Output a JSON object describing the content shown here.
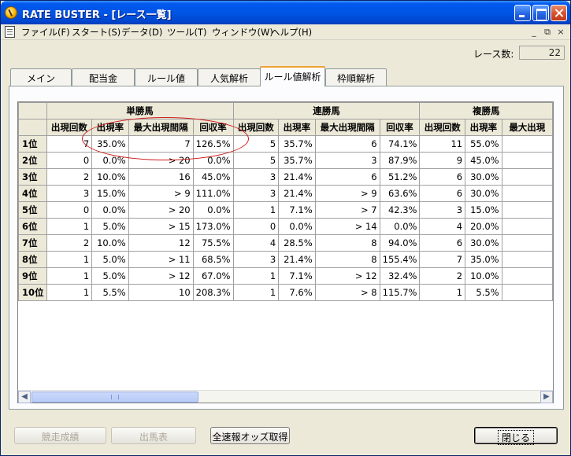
{
  "window": {
    "title": "RATE BUSTER - [レース一覧]"
  },
  "menu": {
    "items": [
      "ファイル(F)",
      "スタート(S)",
      "データ(D)",
      "ツール(T)",
      "ウィンドウ(W)",
      "ヘルプ(H)"
    ],
    "mdi_min": "_",
    "mdi_restore": "⧉",
    "mdi_close": "×"
  },
  "race_count": {
    "label": "レース数:",
    "value": "22"
  },
  "tabs": [
    "メイン",
    "配当金",
    "ルール値",
    "人気解析",
    "ルール値解析",
    "枠順解析"
  ],
  "active_tab": 4,
  "grid": {
    "groups": [
      "単勝馬",
      "連勝馬",
      "複勝馬"
    ],
    "columns": [
      "出現回数",
      "出現率",
      "最大出現間隔",
      "回収率",
      "出現回数",
      "出現率",
      "最大出現間隔",
      "回収率",
      "出現回数",
      "出現率",
      "最大出現"
    ],
    "rows": [
      {
        "label": "1位",
        "cells": [
          "7",
          "35.0%",
          "7",
          "126.5%",
          "5",
          "35.7%",
          "6",
          "74.1%",
          "11",
          "55.0%",
          ""
        ]
      },
      {
        "label": "2位",
        "cells": [
          "0",
          "0.0%",
          "> 20",
          "0.0%",
          "5",
          "35.7%",
          "3",
          "87.9%",
          "9",
          "45.0%",
          ""
        ]
      },
      {
        "label": "3位",
        "cells": [
          "2",
          "10.0%",
          "16",
          "45.0%",
          "3",
          "21.4%",
          "6",
          "51.2%",
          "6",
          "30.0%",
          ""
        ]
      },
      {
        "label": "4位",
        "cells": [
          "3",
          "15.0%",
          "> 9",
          "111.0%",
          "3",
          "21.4%",
          "> 9",
          "63.6%",
          "6",
          "30.0%",
          ""
        ]
      },
      {
        "label": "5位",
        "cells": [
          "0",
          "0.0%",
          "> 20",
          "0.0%",
          "1",
          "7.1%",
          "> 7",
          "42.3%",
          "3",
          "15.0%",
          ""
        ]
      },
      {
        "label": "6位",
        "cells": [
          "1",
          "5.0%",
          "> 15",
          "173.0%",
          "0",
          "0.0%",
          "> 14",
          "0.0%",
          "4",
          "20.0%",
          ""
        ]
      },
      {
        "label": "7位",
        "cells": [
          "2",
          "10.0%",
          "12",
          "75.5%",
          "4",
          "28.5%",
          "8",
          "94.0%",
          "6",
          "30.0%",
          ""
        ]
      },
      {
        "label": "8位",
        "cells": [
          "1",
          "5.0%",
          "> 11",
          "68.5%",
          "3",
          "21.4%",
          "8",
          "155.4%",
          "7",
          "35.0%",
          ""
        ]
      },
      {
        "label": "9位",
        "cells": [
          "1",
          "5.0%",
          "> 12",
          "67.0%",
          "1",
          "7.1%",
          "> 12",
          "32.4%",
          "2",
          "10.0%",
          ""
        ]
      },
      {
        "label": "10位",
        "cells": [
          "1",
          "5.5%",
          "10",
          "208.3%",
          "1",
          "7.6%",
          "> 8",
          "115.7%",
          "1",
          "5.5%",
          ""
        ]
      }
    ]
  },
  "buttons": {
    "race_results": "競走成績",
    "entry_table": "出馬表",
    "fetch_odds": "全速報オッズ取得",
    "close": "閉じる"
  },
  "colors": {
    "titlebar": "#0055E5",
    "annotation_oval": "#D01818",
    "active_tab_accent": "#F0A032"
  }
}
